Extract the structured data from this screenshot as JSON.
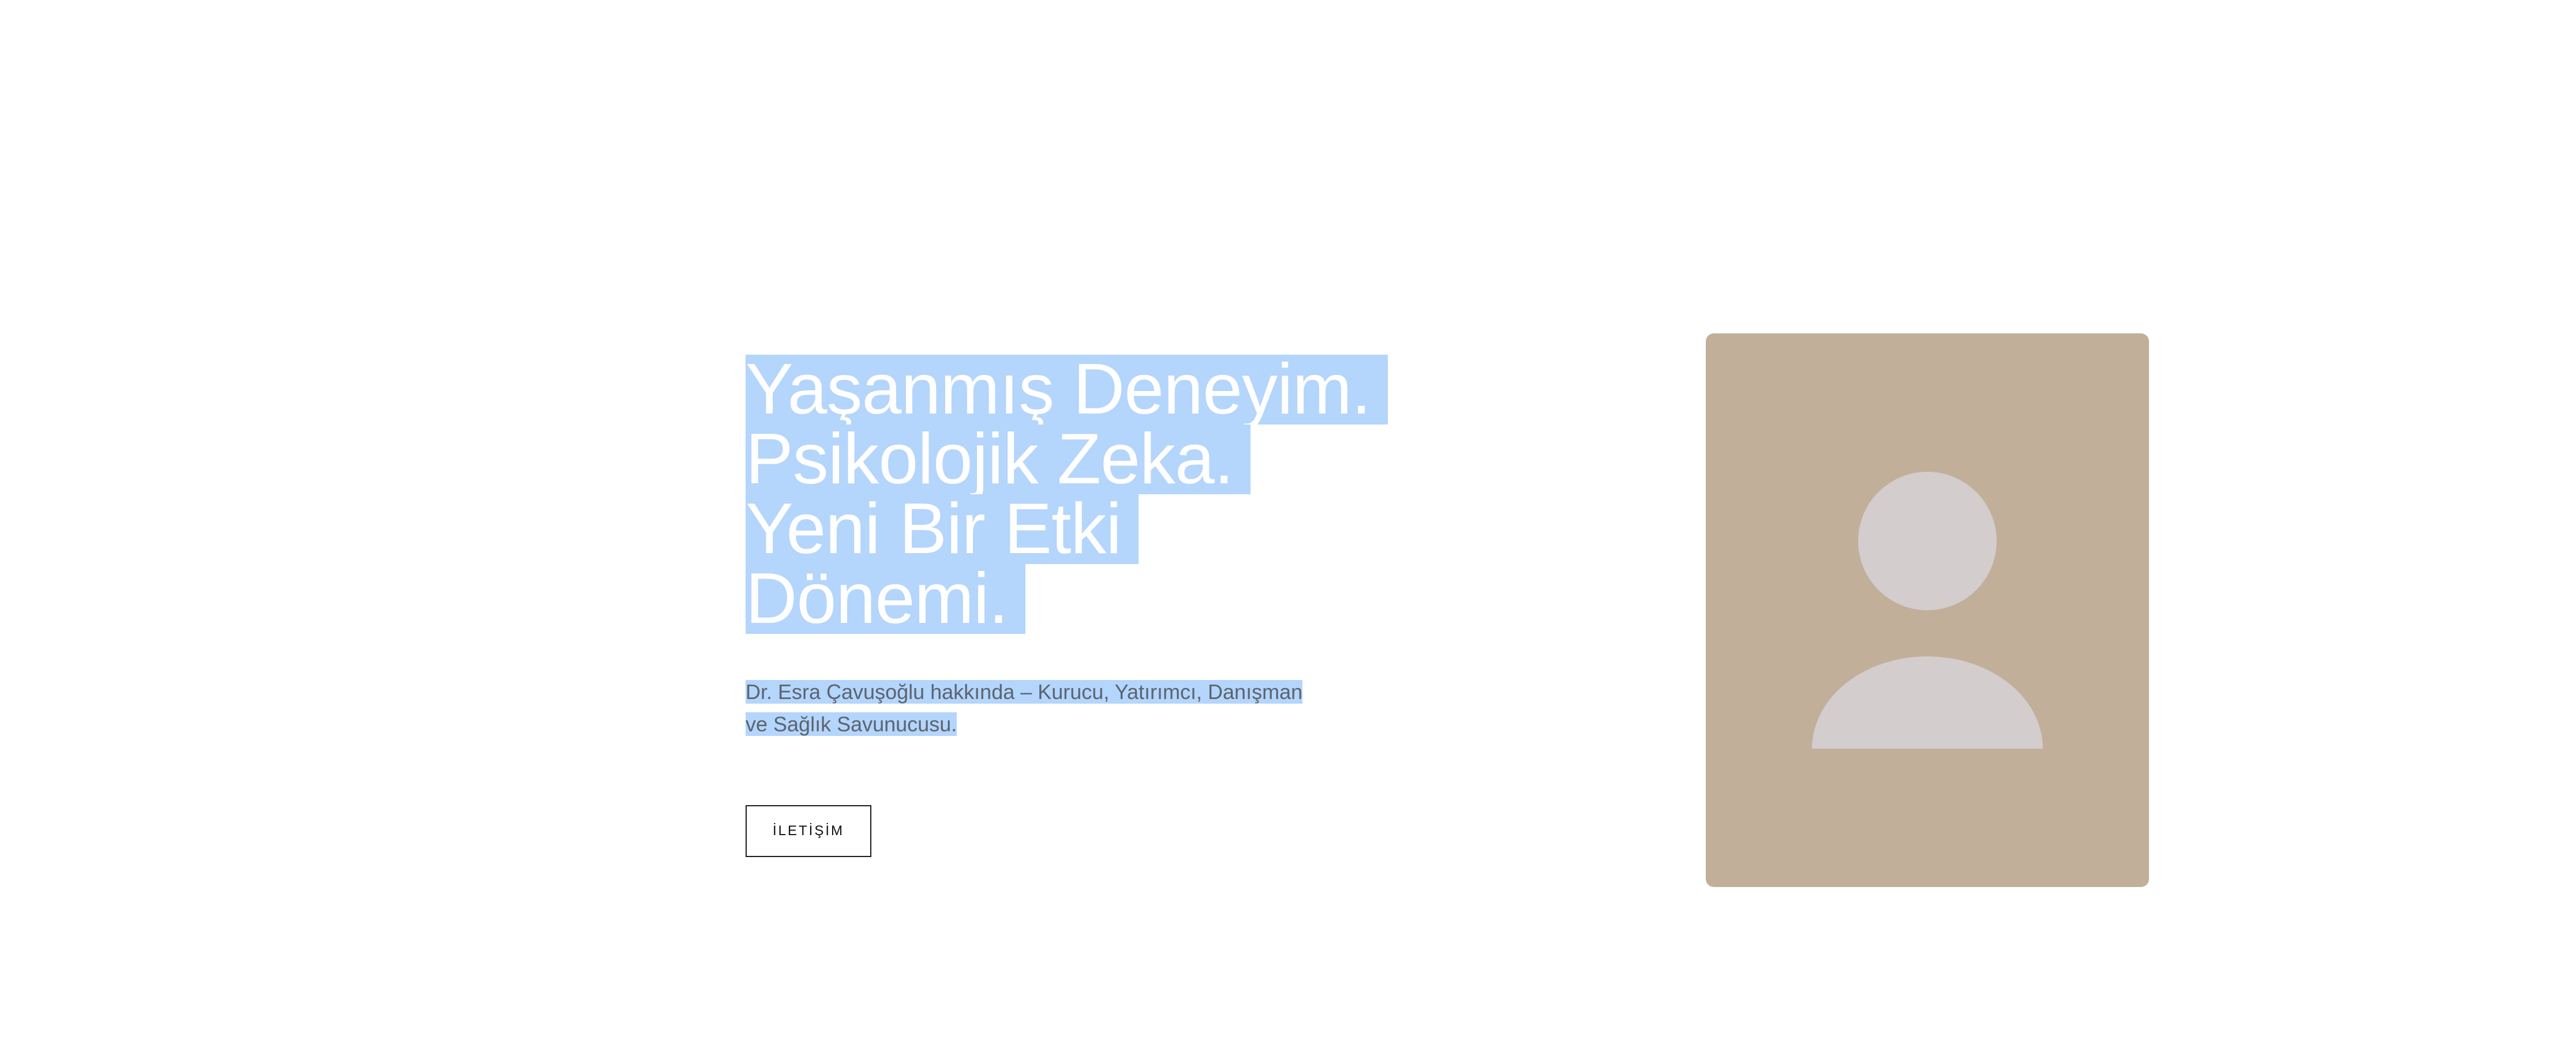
{
  "hero": {
    "headline_lines": [
      "Yaşanmış Deneyim.",
      "Psikolojik Zeka.",
      "Yeni Bir Etki",
      "Dönemi."
    ],
    "subtitle_line1": "Dr. Esra Çavuşoğlu hakkında – Kurucu, Yatırımcı, Danışman",
    "subtitle_line2": "ve Sağlık Savunucusu.",
    "contact_label": "İLETİŞİM"
  },
  "portrait": {
    "icon": "user-avatar-placeholder-icon",
    "card_color": "#c1af9a",
    "figure_color": "#d3cdcd"
  },
  "colors": {
    "selection_highlight": "#b4d5fc",
    "headline_text": "#ffffff",
    "subtitle_text": "#5b6470",
    "button_border": "#1c1c1c"
  }
}
